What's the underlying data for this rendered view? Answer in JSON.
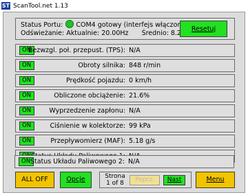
{
  "window": {
    "title": "ScanTool.net 1.13",
    "icon": "ST"
  },
  "status": {
    "port_label": "Status Portu:",
    "port_status": "COM4 gotowy (interfejs włączony)",
    "refresh_label": "Odświeżanie:",
    "refresh_actual": "Aktualnie: 20.00Hz",
    "refresh_avg": "Średnio: 8.25Hz",
    "reset_label": "Resetuj",
    "led_color": "#22c02a"
  },
  "sensors": [
    {
      "toggle": "ON",
      "label": "Bezwzgl. poł. przepust. (TPS):",
      "value": "N/A"
    },
    {
      "toggle": "ON",
      "label": "Obroty silnika:",
      "value": "848 r/min"
    },
    {
      "toggle": "ON",
      "label": "Prędkość pojazdu:",
      "value": "0 km/h"
    },
    {
      "toggle": "ON",
      "label": "Obliczone obciążenie:",
      "value": "21.6%"
    },
    {
      "toggle": "ON",
      "label": "Wyprzedzenie zapłonu:",
      "value": "N/A"
    },
    {
      "toggle": "ON",
      "label": "Ciśnienie w kolektorze:",
      "value": "99 kPa"
    },
    {
      "toggle": "ON",
      "label": "Przepływomierz (MAF):",
      "value": "5.18 g/s"
    },
    {
      "toggle": "ON",
      "label": "Status Układu Paliwowego 1:",
      "value": "N/A"
    },
    {
      "toggle": "ON",
      "label": "Status Układu Paliwowego 2:",
      "value": "N/A"
    }
  ],
  "footer": {
    "all_off": "ALL OFF",
    "opcje": "Opcje",
    "page_label": "Strona",
    "page_of": "1 of 8",
    "prev": "Poprz.",
    "next": "Nast",
    "menu": "Menu"
  }
}
